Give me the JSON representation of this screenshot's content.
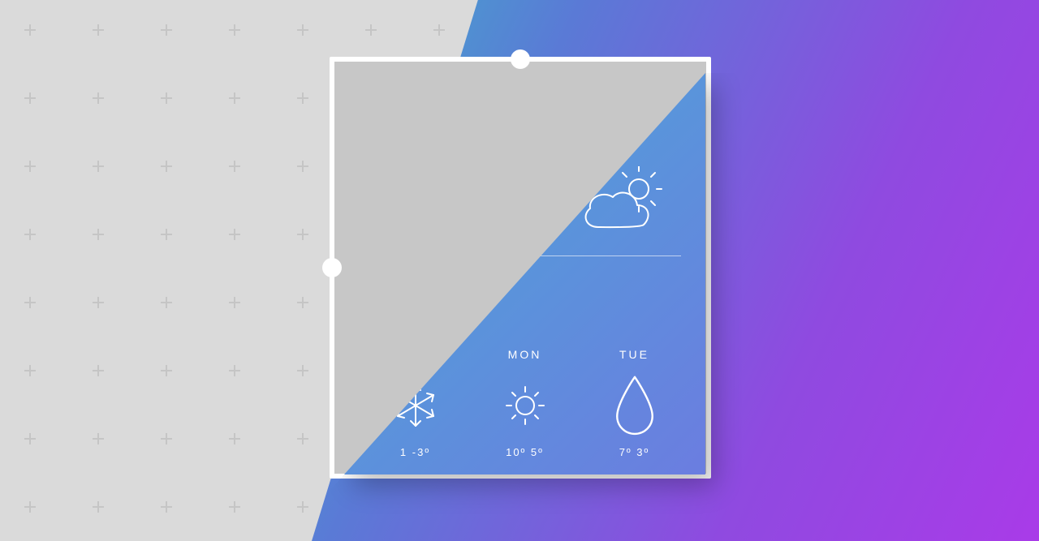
{
  "forecast": {
    "days": [
      {
        "label": "",
        "temps": "1 -3º",
        "icon": "snowflake"
      },
      {
        "label": "MON",
        "temps": "10º 5º",
        "icon": "sun"
      },
      {
        "label": "TUE",
        "temps": "7º 3º",
        "icon": "raindrop"
      }
    ]
  },
  "hero": {
    "icon": "partly-cloudy"
  }
}
